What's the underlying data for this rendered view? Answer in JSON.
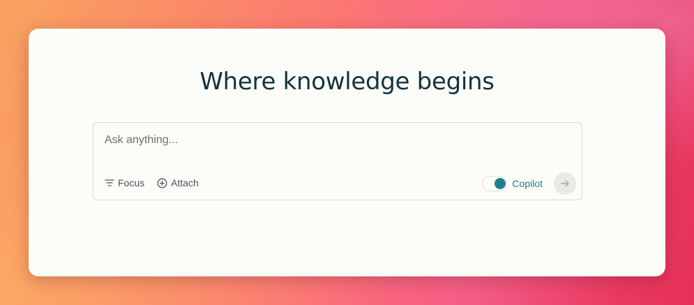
{
  "headline": "Where knowledge begins",
  "search": {
    "placeholder": "Ask anything...",
    "value": ""
  },
  "toolbar": {
    "focus_label": "Focus",
    "focus_icon": "filter-lines-icon",
    "attach_label": "Attach",
    "attach_icon": "plus-circle-icon",
    "copilot_label": "Copilot",
    "copilot_enabled": true,
    "submit_icon": "arrow-right-icon"
  },
  "colors": {
    "accent": "#20808d",
    "heading": "#13343b",
    "card": "#fcfcf9"
  }
}
